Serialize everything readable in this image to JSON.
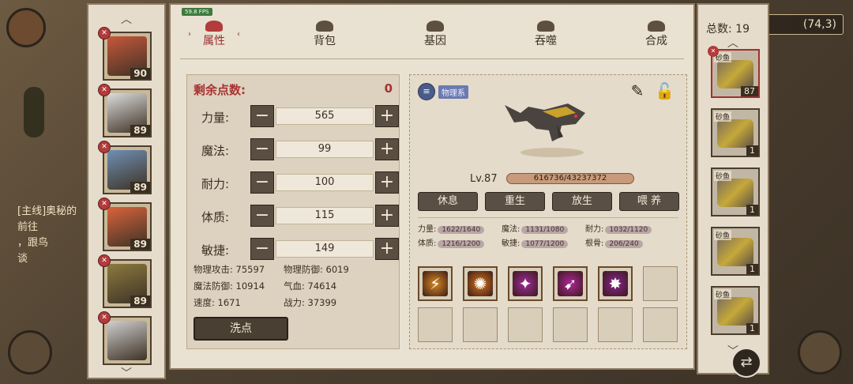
{
  "hud": {
    "coords": "(74,3)",
    "fps": "59.8 FPS",
    "quest_lines": [
      "[主线]奥秘的",
      "前往",
      "，跟鸟",
      "谈"
    ]
  },
  "tabs": [
    {
      "label": "属性",
      "icon": "attribute-icon",
      "active": true
    },
    {
      "label": "背包",
      "icon": "bag-icon",
      "active": false
    },
    {
      "label": "基因",
      "icon": "gene-icon",
      "active": false
    },
    {
      "label": "吞噬",
      "icon": "devour-icon",
      "active": false
    },
    {
      "label": "合成",
      "icon": "synthesis-icon",
      "active": false
    }
  ],
  "heroes": [
    {
      "level": "90",
      "color": "#c7573a"
    },
    {
      "level": "89",
      "color": "#dcdcdc"
    },
    {
      "level": "89",
      "color": "#6f8fb3"
    },
    {
      "level": "89",
      "color": "#d9643c"
    },
    {
      "level": "89",
      "color": "#8b7a3f"
    },
    {
      "level": "",
      "color": "#cfcfcf"
    }
  ],
  "stats": {
    "remaining_label": "剩余点数:",
    "remaining_value": "0",
    "attrs": [
      {
        "name": "力量:",
        "value": "565"
      },
      {
        "name": "魔法:",
        "value": "99"
      },
      {
        "name": "耐力:",
        "value": "100"
      },
      {
        "name": "体质:",
        "value": "115"
      },
      {
        "name": "敏捷:",
        "value": "149"
      }
    ],
    "derived": [
      [
        "物理攻击: 75597",
        "物理防御: 6019"
      ],
      [
        "魔法防御: 10914",
        "气血: 74614"
      ],
      [
        "速度: 1671",
        "战力: 37399"
      ]
    ],
    "wash_label": "洗点"
  },
  "pet": {
    "type_label": "物理系",
    "level": "Lv.87",
    "xp": "616736/43237372",
    "xp_fraction": 0.014,
    "actions": [
      "休息",
      "重生",
      "放生",
      "喂 养"
    ],
    "aptitudes": [
      [
        {
          "k": "力量:",
          "v": "1622/1640"
        },
        {
          "k": "魔法:",
          "v": "1131/1080"
        },
        {
          "k": "耐力:",
          "v": "1032/1120"
        }
      ],
      [
        {
          "k": "体质:",
          "v": "1216/1200"
        },
        {
          "k": "敏捷:",
          "v": "1077/1200"
        },
        {
          "k": "根骨:",
          "v": "206/240"
        }
      ]
    ],
    "skills": [
      {
        "icon": "lightning-skill-icon",
        "glyph": "⚡",
        "color": "#d98a1f"
      },
      {
        "icon": "sun-skill-icon",
        "glyph": "✺",
        "color": "#d4761a"
      },
      {
        "icon": "shatter-skill-icon",
        "glyph": "✦",
        "color": "#a02b9a"
      },
      {
        "icon": "slash-skill-icon",
        "glyph": "➹",
        "color": "#b0279a"
      },
      {
        "icon": "claw-skill-icon",
        "glyph": "✸",
        "color": "#8a2590"
      }
    ]
  },
  "pets": {
    "total_label": "总数: 19",
    "cards": [
      {
        "name": "砂鱼",
        "level": "87"
      },
      {
        "name": "砂鱼",
        "level": "1"
      },
      {
        "name": "砂鱼",
        "level": "1"
      },
      {
        "name": "砂鱼",
        "level": "1"
      },
      {
        "name": "砂鱼",
        "level": "1"
      }
    ]
  }
}
